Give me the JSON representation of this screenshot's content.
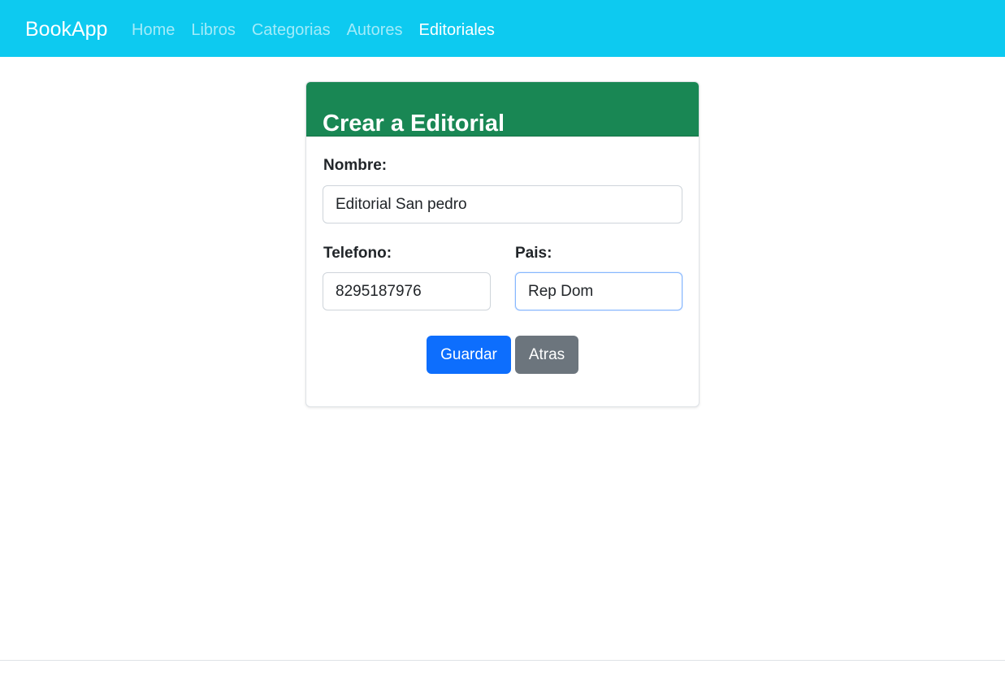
{
  "navbar": {
    "brand": "BookApp",
    "links": [
      {
        "label": "Home",
        "active": false
      },
      {
        "label": "Libros",
        "active": false
      },
      {
        "label": "Categorias",
        "active": false
      },
      {
        "label": "Autores",
        "active": false
      },
      {
        "label": "Editoriales",
        "active": true
      }
    ],
    "background": "#0dcaf0"
  },
  "form": {
    "title": "Crear a Editorial",
    "header_color": "#198754",
    "nombre": {
      "label": "Nombre:",
      "value": "Editorial San pedro"
    },
    "telefono": {
      "label": "Telefono:",
      "value": "8295187976"
    },
    "pais": {
      "label": "Pais:",
      "value": "Rep Dom"
    },
    "buttons": {
      "save": "Guardar",
      "back": "Atras"
    }
  },
  "colors": {
    "primary": "#0d6efd",
    "secondary": "#6c757d"
  }
}
